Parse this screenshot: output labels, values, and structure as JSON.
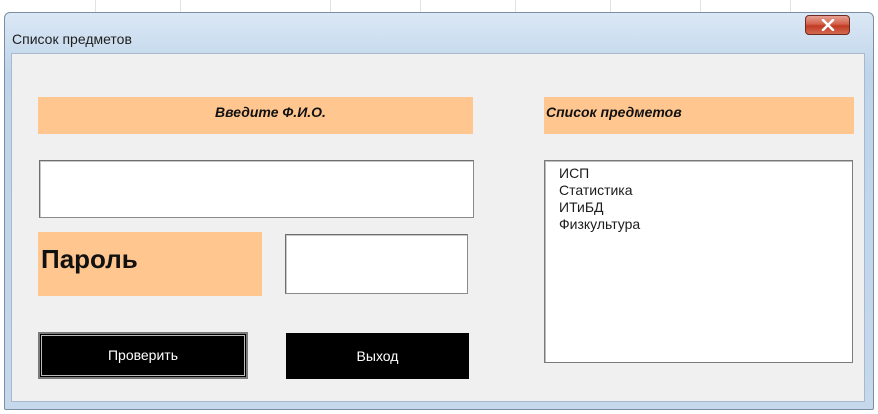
{
  "window": {
    "title": "Список предметов",
    "close_icon": "close-icon"
  },
  "form": {
    "fio_label": "Введите Ф.И.О.",
    "fio_value": "",
    "password_label": "Пароль",
    "password_value": "",
    "subjects_label": "Список предметов",
    "subjects": [
      "ИСП",
      "Статистика",
      "ИТиБД",
      "Физкультура"
    ],
    "check_button": "Проверить",
    "exit_button": "Выход"
  },
  "colors": {
    "label_band": "#ffc690",
    "button_bg": "#000000",
    "button_text": "#ffffff",
    "close_button": "#c8452c"
  }
}
